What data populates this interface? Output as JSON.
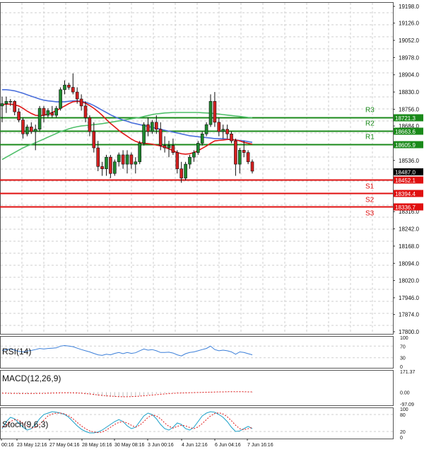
{
  "chart_data": {
    "type": "candlestick",
    "colors": {
      "up": "#1e8a2e",
      "down": "#d42020",
      "ma_blue": "#4a6fdc",
      "ma_red": "#e01818",
      "ma_green": "#4fbf6a",
      "resistance": "#1a8a1a",
      "support": "#e01010",
      "last_price_bg": "#000000",
      "grid": "#cfcfcf"
    },
    "y_ticks": [
      "19198.0",
      "19126.0",
      "19052.0",
      "18978.0",
      "18904.0",
      "18830.0",
      "18756.0",
      "18684.0",
      "18610.0",
      "18536.0",
      "18316.0",
      "18242.0",
      "18168.0",
      "18094.0",
      "18020.0",
      "17946.0",
      "17874.0",
      "17800.0"
    ],
    "x_ticks": [
      "00:16",
      "23 May 12:16",
      "27 May 04:16",
      "28 May 16:16",
      "30 May 08:16",
      "3 Jun 00:16",
      "4 Jun 12:16",
      "6 Jun 04:16",
      "7 Jun 16:16"
    ],
    "last_price": "18487.0",
    "levels": [
      {
        "name": "R3",
        "value": 18721.3,
        "label": "18721.3",
        "kind": "resistance"
      },
      {
        "name": "R2",
        "value": 18663.6,
        "label": "18663.6",
        "kind": "resistance"
      },
      {
        "name": "R1",
        "value": 18605.9,
        "label": "18605.9",
        "kind": "resistance"
      },
      {
        "name": "S1",
        "value": 18452.1,
        "label": "18452.1",
        "kind": "support"
      },
      {
        "name": "S2",
        "value": 18394.4,
        "label": "18394.4",
        "kind": "support"
      },
      {
        "name": "S3",
        "value": 18336.7,
        "label": "18336.7",
        "kind": "support"
      }
    ],
    "candles": [
      [
        18770,
        18810,
        18700,
        18780
      ],
      [
        18780,
        18810,
        18740,
        18790
      ],
      [
        18790,
        18800,
        18770,
        18790
      ],
      [
        18790,
        18795,
        18730,
        18745
      ],
      [
        18745,
        18760,
        18700,
        18710
      ],
      [
        18710,
        18720,
        18630,
        18650
      ],
      [
        18650,
        18690,
        18640,
        18680
      ],
      [
        18680,
        18700,
        18650,
        18660
      ],
      [
        18660,
        18690,
        18580,
        18670
      ],
      [
        18670,
        18770,
        18660,
        18760
      ],
      [
        18760,
        18770,
        18700,
        18730
      ],
      [
        18730,
        18760,
        18720,
        18750
      ],
      [
        18740,
        18770,
        18720,
        18730
      ],
      [
        18730,
        18770,
        18720,
        18760
      ],
      [
        18760,
        18850,
        18750,
        18840
      ],
      [
        18840,
        18880,
        18820,
        18860
      ],
      [
        18860,
        18870,
        18840,
        18850
      ],
      [
        18850,
        18910,
        18820,
        18830
      ],
      [
        18830,
        18850,
        18780,
        18800
      ],
      [
        18800,
        18820,
        18750,
        18770
      ],
      [
        18770,
        18790,
        18700,
        18720
      ],
      [
        18720,
        18730,
        18640,
        18660
      ],
      [
        18660,
        18700,
        18570,
        18590
      ],
      [
        18590,
        18620,
        18490,
        18510
      ],
      [
        18510,
        18530,
        18470,
        18500
      ],
      [
        18500,
        18560,
        18470,
        18550
      ],
      [
        18550,
        18560,
        18460,
        18480
      ],
      [
        18480,
        18540,
        18470,
        18530
      ],
      [
        18530,
        18570,
        18510,
        18560
      ],
      [
        18560,
        18580,
        18500,
        18520
      ],
      [
        18520,
        18580,
        18480,
        18560
      ],
      [
        18560,
        18570,
        18500,
        18520
      ],
      [
        18520,
        18550,
        18480,
        18530
      ],
      [
        18530,
        18620,
        18520,
        18610
      ],
      [
        18610,
        18700,
        18600,
        18690
      ],
      [
        18690,
        18720,
        18640,
        18660
      ],
      [
        18660,
        18710,
        18650,
        18700
      ],
      [
        18700,
        18730,
        18650,
        18670
      ],
      [
        18670,
        18700,
        18580,
        18600
      ],
      [
        18600,
        18640,
        18570,
        18590
      ],
      [
        18590,
        18620,
        18550,
        18600
      ],
      [
        18600,
        18630,
        18560,
        18570
      ],
      [
        18570,
        18580,
        18480,
        18500
      ],
      [
        18500,
        18530,
        18440,
        18460
      ],
      [
        18460,
        18530,
        18450,
        18520
      ],
      [
        18520,
        18560,
        18500,
        18550
      ],
      [
        18550,
        18580,
        18530,
        18570
      ],
      [
        18570,
        18620,
        18560,
        18610
      ],
      [
        18610,
        18660,
        18600,
        18650
      ],
      [
        18650,
        18700,
        18640,
        18690
      ],
      [
        18690,
        18820,
        18680,
        18790
      ],
      [
        18790,
        18830,
        18680,
        18700
      ],
      [
        18700,
        18720,
        18640,
        18660
      ],
      [
        18660,
        18690,
        18630,
        18670
      ],
      [
        18670,
        18690,
        18630,
        18650
      ],
      [
        18650,
        18660,
        18610,
        18620
      ],
      [
        18620,
        18630,
        18470,
        18520
      ],
      [
        18520,
        18590,
        18480,
        18580
      ],
      [
        18580,
        18620,
        18550,
        18570
      ],
      [
        18570,
        18580,
        18520,
        18530
      ],
      [
        18530,
        18540,
        18480,
        18490
      ]
    ],
    "ma_blue": [
      18840,
      18840,
      18838,
      18835,
      18830,
      18825,
      18818,
      18812,
      18806,
      18800,
      18795,
      18792,
      18790,
      18788,
      18788,
      18788,
      18790,
      18792,
      18792,
      18790,
      18786,
      18780,
      18772,
      18762,
      18752,
      18742,
      18732,
      18724,
      18716,
      18710,
      18704,
      18698,
      18694,
      18690,
      18686,
      18682,
      18678,
      18674,
      18670,
      18666,
      18662,
      18658,
      18654,
      18650,
      18646,
      18642,
      18640,
      18638,
      18636,
      18634,
      18632,
      18630,
      18630,
      18629,
      18628,
      18626,
      18624,
      18622,
      18620,
      18617,
      18614
    ],
    "ma_red": [
      18775,
      18778,
      18778,
      18775,
      18770,
      18760,
      18748,
      18738,
      18730,
      18728,
      18730,
      18735,
      18742,
      18750,
      18760,
      18770,
      18780,
      18788,
      18790,
      18788,
      18782,
      18772,
      18760,
      18746,
      18730,
      18712,
      18695,
      18680,
      18665,
      18652,
      18640,
      18628,
      18618,
      18612,
      18610,
      18608,
      18606,
      18602,
      18598,
      18592,
      18586,
      18578,
      18570,
      18565,
      18563,
      18565,
      18570,
      18578,
      18588,
      18598,
      18610,
      18620,
      18622,
      18624,
      18626,
      18626,
      18624,
      18620,
      18614,
      18610,
      18606
    ],
    "ma_green": [
      18540,
      18550,
      18560,
      18570,
      18580,
      18590,
      18598,
      18605,
      18612,
      18620,
      18628,
      18636,
      18644,
      18652,
      18660,
      18666,
      18672,
      18677,
      18681,
      18684,
      18686,
      18688,
      18690,
      18692,
      18694,
      18697,
      18700,
      18703,
      18706,
      18709,
      18712,
      18715,
      18718,
      18721,
      18725,
      18729,
      18733,
      18736,
      18738,
      18740,
      18741,
      18742,
      18742,
      18742,
      18742,
      18742,
      18742,
      18742,
      18741,
      18740,
      18739,
      18737,
      18735,
      18733,
      18731,
      18729,
      18727,
      18725,
      18723,
      18721,
      18720
    ],
    "indicators": [
      {
        "name": "RSI(14)",
        "ticks": [
          "100",
          "70",
          "30",
          "0"
        ],
        "values": [
          55,
          58,
          60,
          56,
          52,
          50,
          53,
          55,
          58,
          62,
          60,
          62,
          63,
          64,
          70,
          72,
          70,
          68,
          63,
          58,
          54,
          50,
          45,
          40,
          38,
          42,
          40,
          45,
          48,
          44,
          48,
          45,
          47,
          54,
          60,
          56,
          58,
          54,
          48,
          48,
          49,
          46,
          40,
          36,
          44,
          48,
          50,
          54,
          58,
          62,
          70,
          58,
          54,
          56,
          54,
          50,
          42,
          50,
          48,
          44,
          40
        ]
      },
      {
        "name": "MACD(12,26,9)",
        "ticks": [
          "171.37",
          "0.00",
          "-97.09"
        ],
        "hist": [
          -8,
          -10,
          -12,
          -13,
          -14,
          -15,
          -15,
          -14,
          -13,
          -11,
          -9,
          -7,
          -6,
          -5,
          -5,
          -5,
          -6,
          -7,
          -9,
          -12,
          -16,
          -20,
          -25,
          -30,
          -34,
          -37,
          -39,
          -40,
          -41,
          -40,
          -39,
          -37,
          -34,
          -30,
          -26,
          -22,
          -18,
          -15,
          -12,
          -10,
          -8,
          -7,
          -6,
          -6,
          -6,
          -6,
          -7,
          -6,
          -5,
          -4,
          -3,
          -3,
          -3,
          -3,
          -3,
          -3,
          -3,
          -3,
          -3,
          -3,
          -4
        ],
        "signal": [
          -9,
          -9,
          -10,
          -10,
          -11,
          -11,
          -11,
          -11,
          -11,
          -10,
          -10,
          -9,
          -8,
          -7,
          -6,
          -5,
          -5,
          -6,
          -7,
          -9,
          -12,
          -15,
          -19,
          -23,
          -27,
          -30,
          -33,
          -35,
          -37,
          -38,
          -38,
          -37,
          -35,
          -33,
          -30,
          -27,
          -24,
          -21,
          -18,
          -15,
          -12,
          -10,
          -8,
          -7,
          -6,
          -5,
          -4,
          -3,
          -2,
          -1,
          0,
          1,
          2,
          2,
          3,
          3,
          3,
          3,
          3,
          2,
          2
        ]
      },
      {
        "name": "Stoch(9,6,3)",
        "ticks": [
          "100",
          "80",
          "20",
          "0"
        ],
        "k": [
          30,
          55,
          70,
          65,
          50,
          35,
          25,
          30,
          45,
          65,
          80,
          85,
          90,
          88,
          85,
          80,
          70,
          55,
          40,
          28,
          20,
          15,
          15,
          18,
          25,
          35,
          45,
          55,
          62,
          55,
          40,
          30,
          35,
          55,
          75,
          85,
          80,
          65,
          45,
          30,
          25,
          35,
          50,
          45,
          30,
          25,
          35,
          55,
          75,
          85,
          90,
          88,
          80,
          70,
          55,
          35,
          20,
          22,
          30,
          38,
          30
        ],
        "d": [
          35,
          42,
          55,
          62,
          60,
          50,
          40,
          32,
          35,
          45,
          60,
          75,
          82,
          85,
          85,
          82,
          75,
          65,
          52,
          40,
          30,
          22,
          18,
          16,
          18,
          25,
          35,
          45,
          52,
          55,
          50,
          42,
          35,
          42,
          55,
          70,
          78,
          75,
          65,
          50,
          38,
          32,
          38,
          42,
          40,
          34,
          30,
          36,
          48,
          62,
          75,
          84,
          86,
          82,
          72,
          58,
          42,
          30,
          26,
          30,
          34
        ]
      }
    ]
  }
}
